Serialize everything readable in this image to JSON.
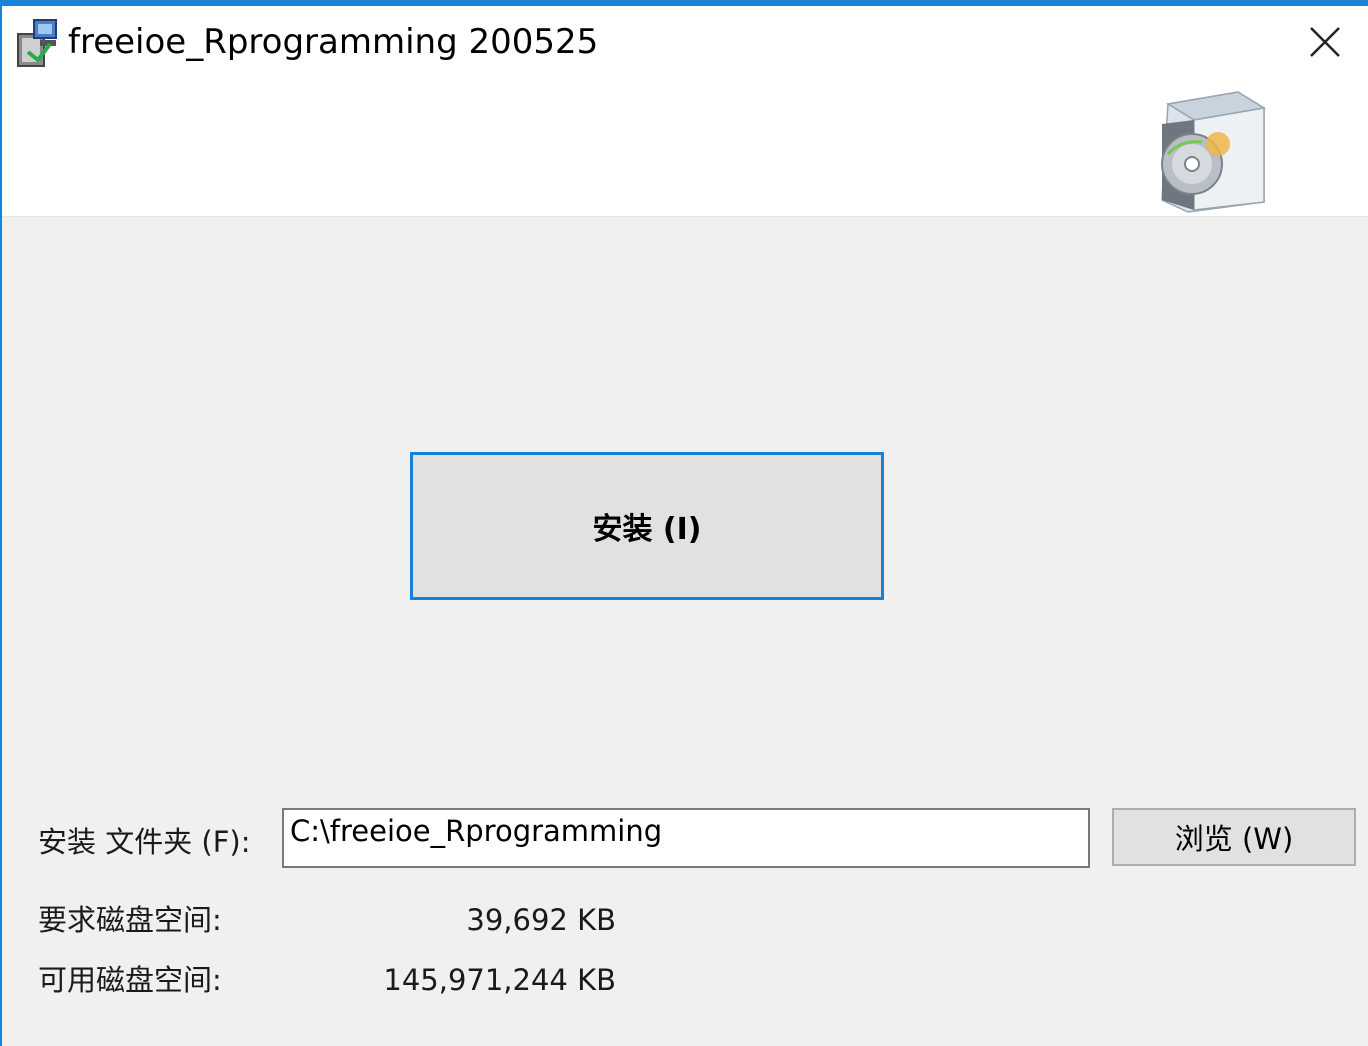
{
  "window": {
    "title": "freeioe_Rprogramming 200525",
    "accent_color": "#1883d7"
  },
  "icons": {
    "app": "installer-package-icon",
    "close": "close-icon",
    "header": "setup-cd-box-icon"
  },
  "main": {
    "install_label": "安装 (I)"
  },
  "folder": {
    "label": "安装 文件夹 (F):",
    "value": "C:\\freeioe_Rprogramming",
    "browse_label": "浏览 (W)"
  },
  "disk": {
    "required_label": "要求磁盘空间:",
    "required_value": "39,692 KB",
    "available_label": "可用磁盘空间:",
    "available_value": "145,971,244 KB"
  }
}
